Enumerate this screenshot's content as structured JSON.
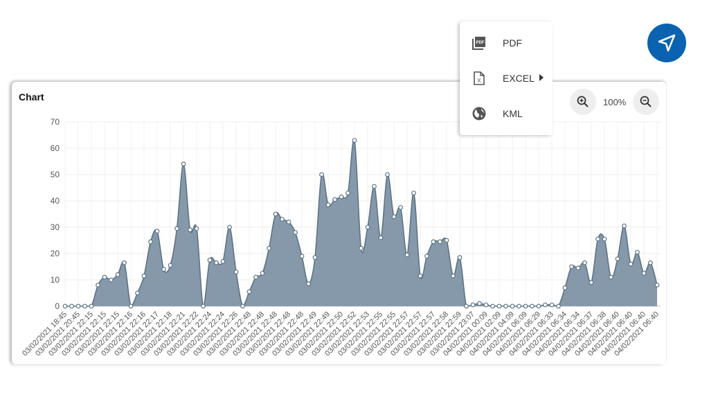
{
  "chart_title": "Chart",
  "zoom": {
    "level": "100%"
  },
  "export_menu": {
    "items": [
      {
        "label": "PDF",
        "icon": "pdf-file-icon"
      },
      {
        "label": "EXCEL",
        "icon": "excel-file-icon",
        "has_submenu": true
      },
      {
        "label": "KML",
        "icon": "globe-icon"
      }
    ]
  },
  "send_button": {
    "icon": "send-navigation-icon"
  },
  "colors": {
    "area_fill": "#7f93a6",
    "line": "#5d7385",
    "fab": "#0a62b0"
  },
  "chart_data": {
    "type": "area",
    "ylim": [
      0,
      70
    ],
    "yticks": [
      0,
      10,
      20,
      30,
      40,
      50,
      60,
      70
    ],
    "grid": true,
    "x": [
      "03/02/2021 18:45",
      "03/02/2021 20:45",
      "03/02/2021 22:15",
      "03/02/2021 22:15",
      "03/02/2021 22:15",
      "03/02/2021 22:16",
      "03/02/2021 22:16",
      "03/02/2021 22:17",
      "03/02/2021 22:18",
      "03/02/2021 22:21",
      "03/02/2021 22:22",
      "03/02/2021 22:24",
      "03/02/2021 22:24",
      "03/02/2021 22:26",
      "03/02/2021 22:48",
      "03/02/2021 22:48",
      "03/02/2021 22:48",
      "03/02/2021 22:48",
      "03/02/2021 22:48",
      "03/02/2021 22:49",
      "03/02/2021 22:49",
      "03/02/2021 22:50",
      "03/02/2021 22:52",
      "03/02/2021 22:53",
      "03/02/2021 22:55",
      "03/02/2021 22:55",
      "03/02/2021 22:57",
      "03/02/2021 22:57",
      "03/02/2021 22:57",
      "03/02/2021 22:58",
      "03/02/2021 22:59",
      "03/02/2021 23:07",
      "04/02/2021 00:09",
      "04/02/2021 02:09",
      "04/02/2021 04:09",
      "04/02/2021 06:09",
      "04/02/2021 06:29",
      "04/02/2021 06:33",
      "04/02/2021 06:34",
      "04/02/2021 06:34",
      "04/02/2021 06:37",
      "04/02/2021 06:38",
      "04/02/2021 06:40",
      "04/02/2021 06:40",
      "04/02/2021 06:40",
      "04/02/2021 06:40"
    ],
    "values": [
      0,
      0,
      0,
      0,
      0,
      8,
      11,
      10,
      12,
      16.5,
      0,
      5,
      11.5,
      24.5,
      28.5,
      14,
      15.5,
      29.5,
      54,
      29,
      29.5,
      0,
      17.5,
      16.5,
      17,
      30,
      13,
      0,
      5.5,
      11,
      12.5,
      22,
      35,
      33,
      32,
      28,
      19,
      8.5,
      18.5,
      50,
      38.5,
      40.5,
      41.5,
      43,
      63,
      22,
      30,
      45.5,
      26,
      50,
      34,
      37.5,
      19.5,
      43,
      11.5,
      19,
      24.5,
      24.5,
      25,
      11.5,
      18.5,
      0,
      0.5,
      1,
      0.5,
      0,
      0,
      0,
      0,
      0,
      0,
      0,
      0,
      0.5,
      0.5,
      0,
      7,
      15,
      14.5,
      16.5,
      9,
      25.5,
      25.5,
      11,
      18,
      30.5,
      16,
      20.5,
      12.5,
      16.5,
      8
    ]
  }
}
